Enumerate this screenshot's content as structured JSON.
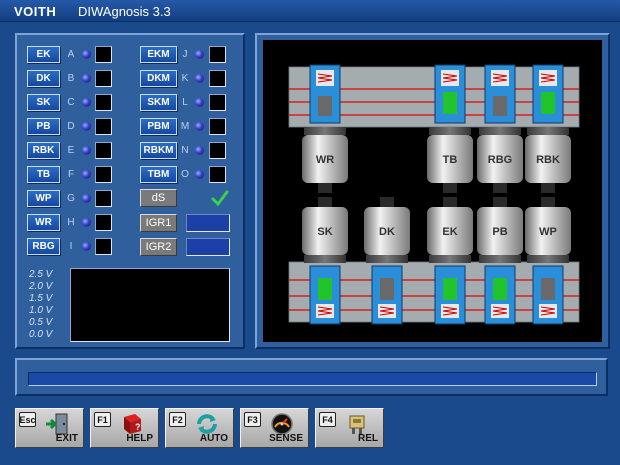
{
  "app": {
    "brand": "VOITH",
    "title": "DIWAgnosis 3.3"
  },
  "signals": {
    "left": [
      {
        "label": "EK",
        "letter": "A"
      },
      {
        "label": "DK",
        "letter": "B"
      },
      {
        "label": "SK",
        "letter": "C"
      },
      {
        "label": "PB",
        "letter": "D"
      },
      {
        "label": "RBK",
        "letter": "E"
      },
      {
        "label": "TB",
        "letter": "F"
      },
      {
        "label": "WP",
        "letter": "G"
      },
      {
        "label": "WR",
        "letter": "H"
      },
      {
        "label": "RBG",
        "letter": "I"
      }
    ],
    "right": [
      {
        "label": "EKM",
        "letter": "J"
      },
      {
        "label": "DKM",
        "letter": "K"
      },
      {
        "label": "SKM",
        "letter": "L"
      },
      {
        "label": "PBM",
        "letter": "M"
      },
      {
        "label": "RBKM",
        "letter": "N"
      },
      {
        "label": "TBM",
        "letter": "O"
      }
    ],
    "extra": {
      "ds_label": "dS",
      "igr1_label": "IGR1",
      "igr2_label": "IGR2",
      "ds_status": "check"
    }
  },
  "voltage_scale": [
    "2.5 V",
    "2.0 V",
    "1.5 V",
    "1.0 V",
    "0.5 V",
    "0.0 V"
  ],
  "diagram": {
    "valves_top": [
      "WR",
      "TB",
      "RBG",
      "RBK"
    ],
    "valves_bottom": [
      "SK",
      "DK",
      "EK",
      "PB",
      "WP"
    ]
  },
  "progress": {
    "value": 0
  },
  "function_keys": [
    {
      "code": "Esc",
      "label": "EXIT",
      "icon": "exit-door-icon"
    },
    {
      "code": "F1",
      "label": "HELP",
      "icon": "help-book-icon"
    },
    {
      "code": "F2",
      "label": "AUTO",
      "icon": "auto-cycle-icon"
    },
    {
      "code": "F3",
      "label": "SENSE",
      "icon": "gauge-icon"
    },
    {
      "code": "F4",
      "label": "REL",
      "icon": "relay-icon"
    }
  ],
  "colors": {
    "background": "#1b4a8c",
    "panel": "#305f9e",
    "led": "#3540c8",
    "check": "#39d24a",
    "piston_green": "#22c42e",
    "housing_red": "#d32020"
  }
}
